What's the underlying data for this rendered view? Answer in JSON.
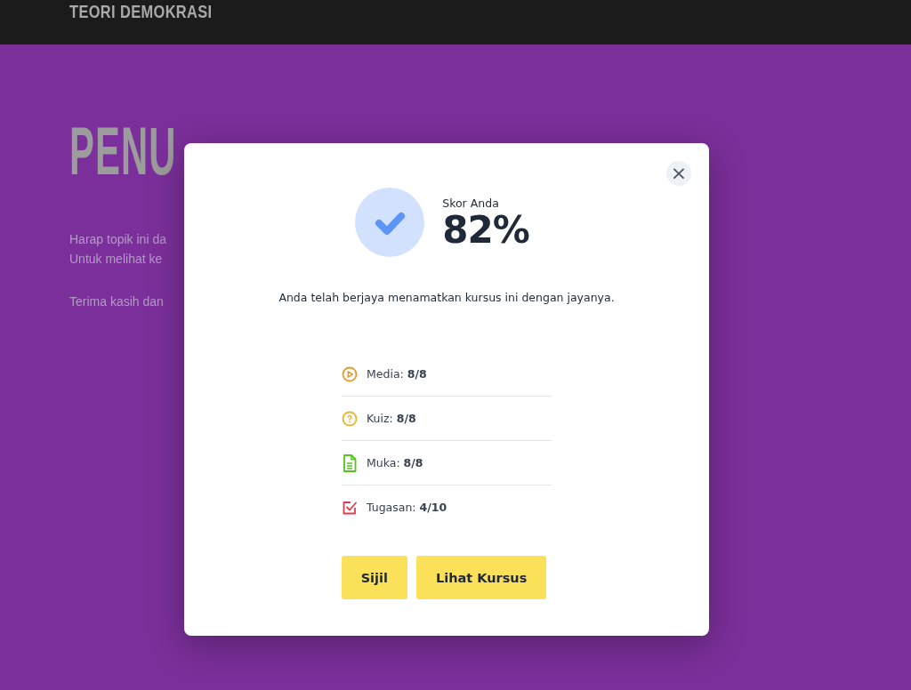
{
  "header": {
    "title": "TEORI DEMOKRASI"
  },
  "page": {
    "heading": "PENU",
    "paragraphs": [
      "Harap topik ini da",
      "Untuk melihat ke",
      "Terima kasih dan"
    ]
  },
  "dialog": {
    "close": "×",
    "score_label": "Skor Anda",
    "score": "82%",
    "message": "Anda telah berjaya menamatkan kursus ini dengan jayanya.",
    "stats": [
      {
        "kind": "media",
        "text": "Media: **8/8**"
      },
      {
        "kind": "quiz",
        "text": "Kuiz: **8/8**"
      },
      {
        "kind": "page",
        "text": "Muka: **8/8**"
      },
      {
        "kind": "assignment",
        "text": "Tugasan: **4/10**"
      }
    ],
    "buttons": [
      "Sijil",
      "Lihat Kursus"
    ]
  }
}
